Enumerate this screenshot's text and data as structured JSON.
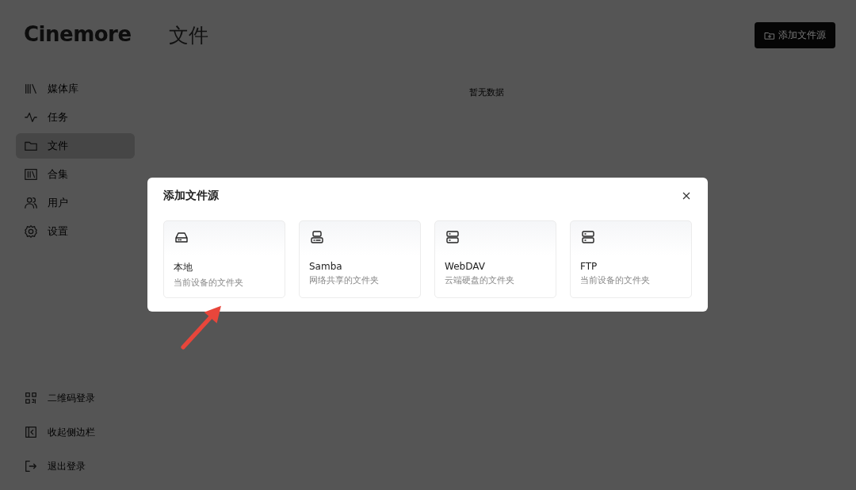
{
  "app": {
    "logo": "Cinemore"
  },
  "sidebar": {
    "items": [
      {
        "label": "媒体库",
        "kind": "library",
        "selected": false
      },
      {
        "label": "任务",
        "kind": "activity",
        "selected": false
      },
      {
        "label": "文件",
        "kind": "folder",
        "selected": true
      },
      {
        "label": "合集",
        "kind": "collection",
        "selected": false
      },
      {
        "label": "用户",
        "kind": "users",
        "selected": false
      },
      {
        "label": "设置",
        "kind": "settings",
        "selected": false
      }
    ],
    "footer_items": [
      {
        "label": "二维码登录",
        "kind": "qrcode"
      },
      {
        "label": "收起侧边栏",
        "kind": "collapse"
      },
      {
        "label": "退出登录",
        "kind": "logout"
      }
    ]
  },
  "page": {
    "title": "文件",
    "add_button": "添加文件源",
    "empty_text": "暂无数据"
  },
  "dialog": {
    "title": "添加文件源",
    "options": [
      {
        "name": "本地",
        "description": "当前设备的文件夹",
        "kind": "drive"
      },
      {
        "name": "Samba",
        "description": "网络共享的文件夹",
        "kind": "network"
      },
      {
        "name": "WebDAV",
        "description": "云端硬盘的文件夹",
        "kind": "server"
      },
      {
        "name": "FTP",
        "description": "当前设备的文件夹",
        "kind": "server"
      }
    ]
  }
}
